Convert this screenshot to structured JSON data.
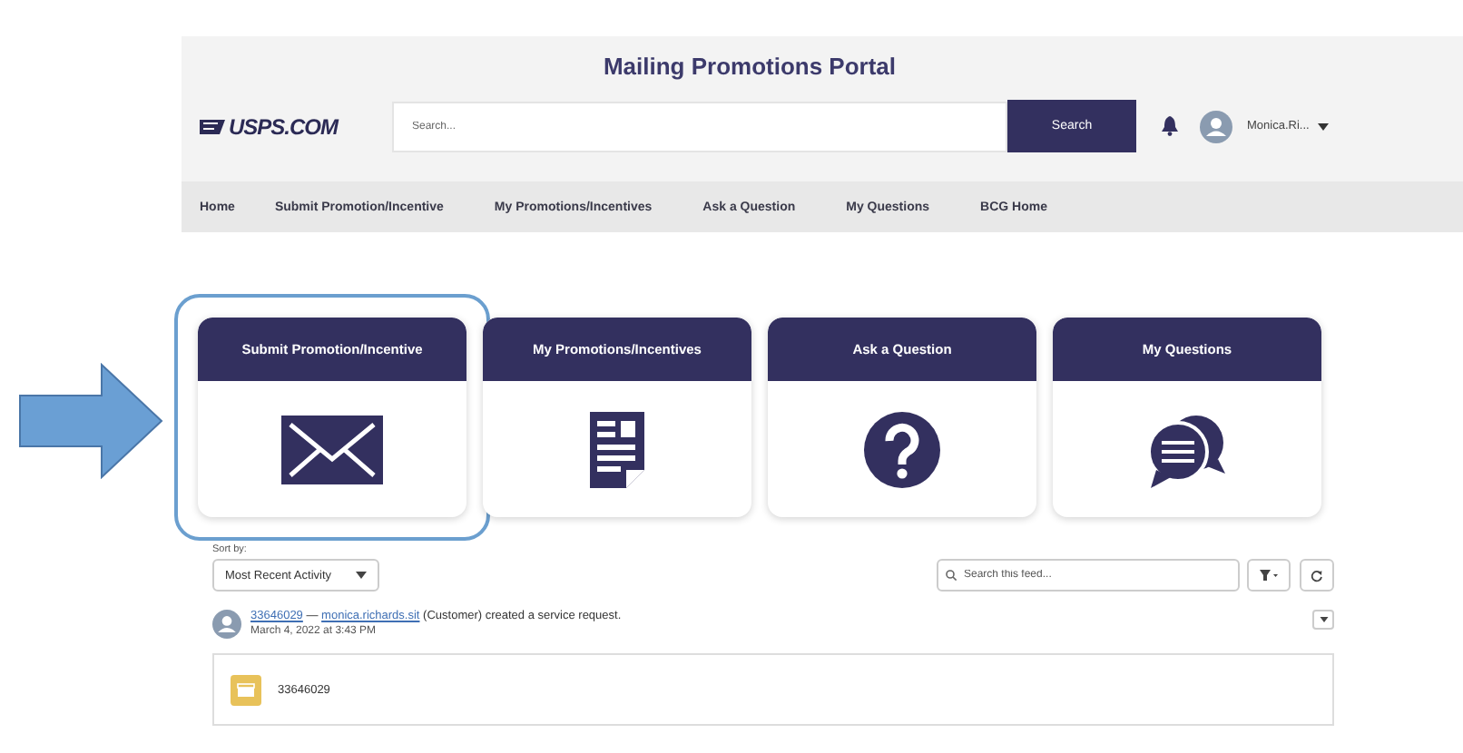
{
  "header": {
    "title": "Mailing Promotions Portal",
    "logo": "USPS.COM",
    "search": {
      "placeholder": "Search...",
      "button": "Search"
    },
    "user": "Monica.Ri..."
  },
  "nav": [
    {
      "label": "Home"
    },
    {
      "label": "Submit Promotion/Incentive"
    },
    {
      "label": "My Promotions/Incentives"
    },
    {
      "label": "Ask a Question"
    },
    {
      "label": "My Questions"
    },
    {
      "label": "BCG Home"
    }
  ],
  "tiles": [
    {
      "title": "Submit Promotion/Incentive",
      "kind": "envelope",
      "selected": true
    },
    {
      "title": "My Promotions/Incentives",
      "kind": "document",
      "selected": false
    },
    {
      "title": "Ask a Question",
      "kind": "question",
      "selected": false
    },
    {
      "title": "My Questions",
      "kind": "chat",
      "selected": false
    }
  ],
  "feed": {
    "sort_label": "Sort by:",
    "sort_value": "Most Recent Activity",
    "search": {
      "placeholder": "Search this feed..."
    },
    "post": {
      "case_link": "33646029",
      "separator": "—",
      "user_link": "monica.richards.sit",
      "text": "(Customer) created a service request.",
      "date": "March 4, 2022 at 3:43 PM"
    },
    "card": {
      "title": "33646029"
    }
  }
}
